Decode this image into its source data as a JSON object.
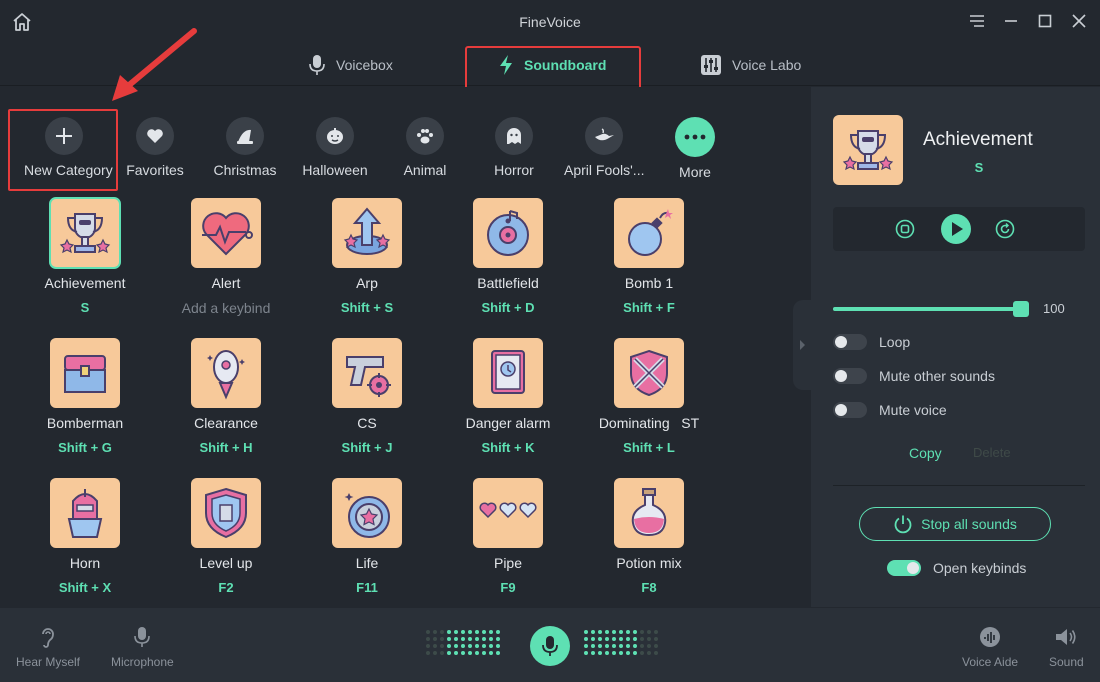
{
  "app": {
    "title": "FineVoice"
  },
  "tabs": [
    {
      "label": "Voicebox",
      "icon": "mic-icon",
      "active": false
    },
    {
      "label": "Soundboard",
      "icon": "bolt-icon",
      "active": true
    },
    {
      "label": "Voice Labo",
      "icon": "sliders-icon",
      "active": false
    }
  ],
  "categories": [
    {
      "label": "New Category",
      "icon": "plus-icon"
    },
    {
      "label": "Favorites",
      "icon": "heart-icon"
    },
    {
      "label": "Christmas",
      "icon": "hat-icon"
    },
    {
      "label": "Halloween",
      "icon": "pumpkin-icon"
    },
    {
      "label": "Animal",
      "icon": "paw-icon"
    },
    {
      "label": "Horror",
      "icon": "ghost-icon"
    },
    {
      "label": "April Fools'...",
      "icon": "lamp-icon"
    },
    {
      "label": "More",
      "icon": "more-icon"
    }
  ],
  "sounds": [
    {
      "name": "Achievement",
      "key": "S",
      "icon": "trophy-icon",
      "selected": true
    },
    {
      "name": "Alert",
      "key": "Add a keybind",
      "icon": "heartbeat-icon",
      "no_key": true
    },
    {
      "name": "Arp",
      "key": "Shift + S",
      "icon": "arrow-badge-icon"
    },
    {
      "name": "Battlefield",
      "key": "Shift + D",
      "icon": "disc-icon"
    },
    {
      "name": "Bomb 1",
      "key": "Shift + F",
      "icon": "bomb-icon"
    },
    {
      "name": "Bomberman",
      "key": "Shift + G",
      "icon": "chest-icon"
    },
    {
      "name": "Clearance",
      "key": "Shift + H",
      "icon": "rocket-icon"
    },
    {
      "name": "CS",
      "key": "Shift + J",
      "icon": "gun-icon"
    },
    {
      "name": "Danger alarm",
      "key": "Shift + K",
      "icon": "book-icon"
    },
    {
      "name": "Dominating   ST",
      "key": "Shift + L",
      "icon": "swords-icon"
    },
    {
      "name": "Horn",
      "key": "Shift + X",
      "icon": "knight-icon"
    },
    {
      "name": "Level up",
      "key": "F2",
      "icon": "shield-icon"
    },
    {
      "name": "Life",
      "key": "F11",
      "icon": "coin-icon"
    },
    {
      "name": "Pipe",
      "key": "F9",
      "icon": "hearts-icon"
    },
    {
      "name": "Potion mix",
      "key": "F8",
      "icon": "potion-icon"
    }
  ],
  "detail": {
    "name": "Achievement",
    "key": "S",
    "volume": 100,
    "volume_label": "100",
    "options": [
      {
        "label": "Loop",
        "on": false
      },
      {
        "label": "Mute other sounds",
        "on": false
      },
      {
        "label": "Mute voice",
        "on": false
      }
    ],
    "copy_label": "Copy",
    "delete_label": "Delete",
    "stop_label": "Stop all sounds",
    "keybinds_label": "Open keybinds",
    "keybinds_on": true
  },
  "bottom": {
    "hear_myself": "Hear Myself",
    "microphone": "Microphone",
    "voice_aide": "Voice Aide",
    "sound": "Sound"
  },
  "colors": {
    "accent": "#5ee0b3",
    "tile": "#f7c99a",
    "annotation": "#e63c3c"
  }
}
